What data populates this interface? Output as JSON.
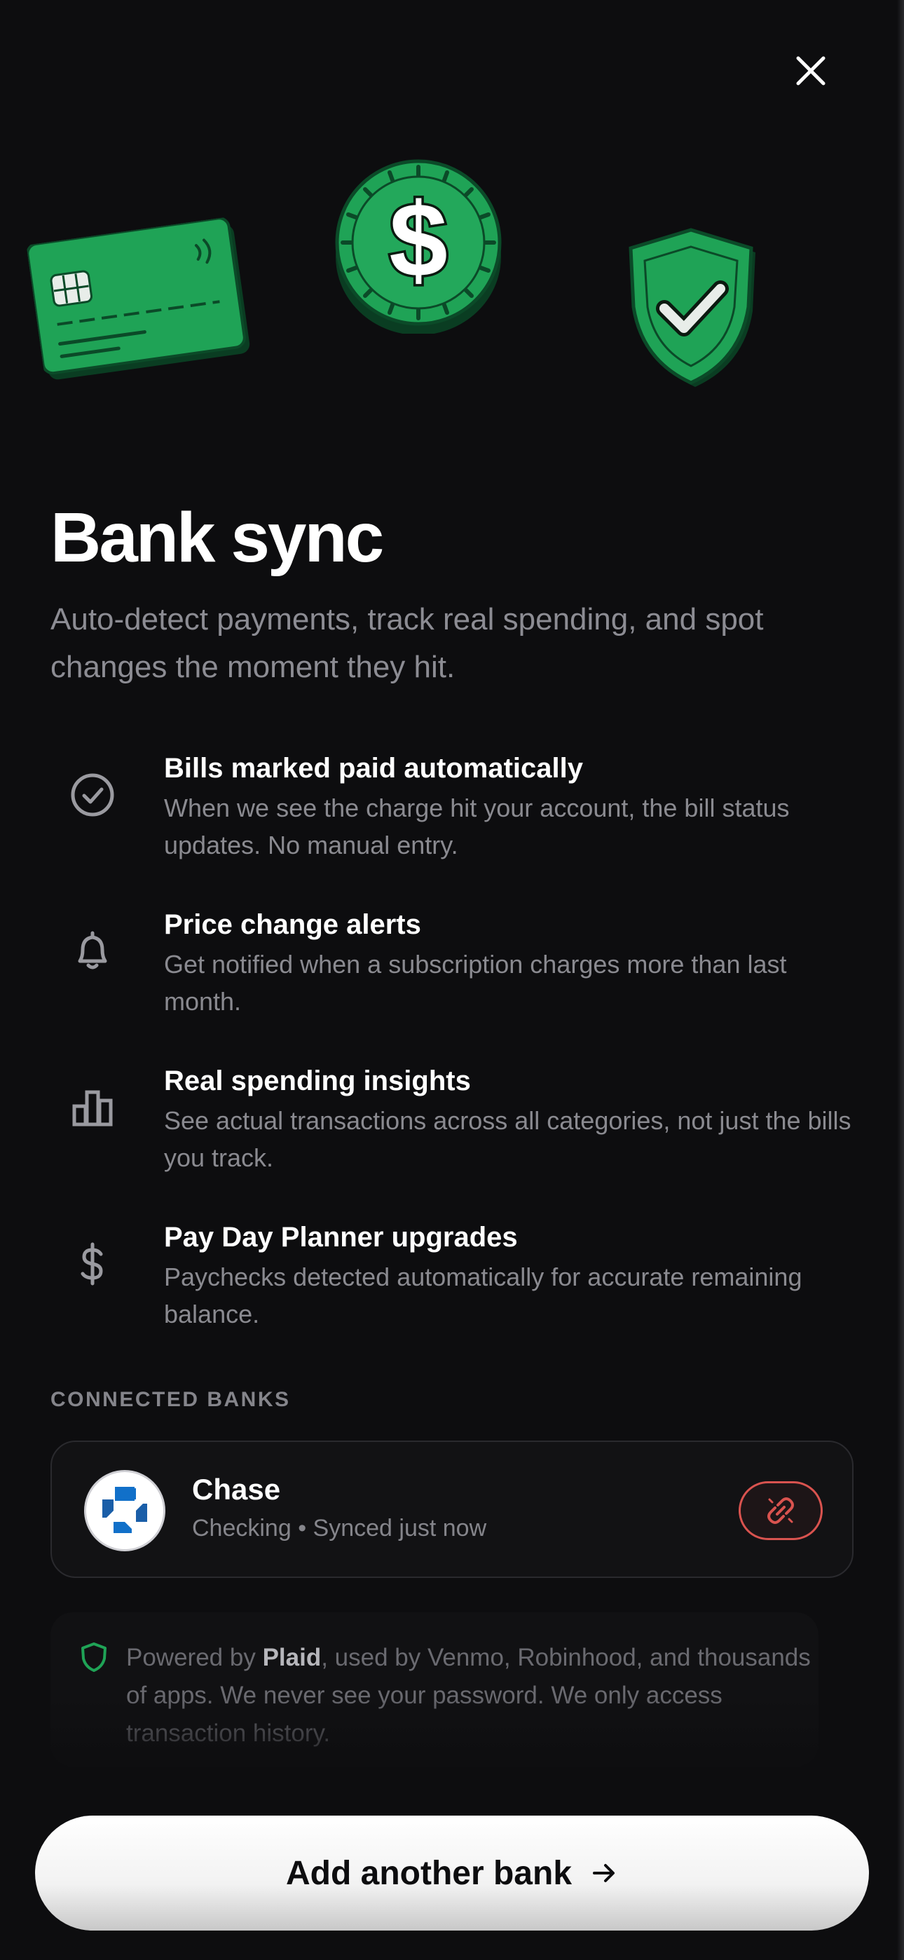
{
  "header": {
    "close_icon": "close-icon"
  },
  "hero": {
    "icons": [
      "credit-card-icon",
      "dollar-coin-icon",
      "shield-check-icon"
    ],
    "accent": "#22a25a"
  },
  "title": "Bank sync",
  "subtitle": "Auto-detect payments, track real spending, and spot changes the moment they hit.",
  "features": [
    {
      "icon": "check-circle-icon",
      "title": "Bills marked paid automatically",
      "description": "When we see the charge hit your account, the bill status updates. No manual entry."
    },
    {
      "icon": "bell-icon",
      "title": "Price change alerts",
      "description": "Get notified when a subscription charges more than last month."
    },
    {
      "icon": "bar-chart-icon",
      "title": "Real spending insights",
      "description": "See actual transactions across all categories, not just the bills you track."
    },
    {
      "icon": "dollar-icon",
      "title": "Pay Day Planner upgrades",
      "description": "Paychecks detected automatically for accurate remaining balance."
    }
  ],
  "connected_banks": {
    "label": "CONNECTED BANKS",
    "items": [
      {
        "name": "Chase",
        "meta": "Checking • Synced just now",
        "logo_icon": "chase-logo",
        "action_icon": "unlink-icon",
        "action_color": "#d9534f"
      }
    ]
  },
  "privacy": {
    "icon": "shield-icon",
    "prefix": "Powered by ",
    "brand": "Plaid",
    "suffix": ", used by Venmo, Robinhood, and thousands of apps. We never see your password. We only access transaction history."
  },
  "cta": {
    "label": "Add another bank",
    "icon": "arrow-right-icon"
  }
}
